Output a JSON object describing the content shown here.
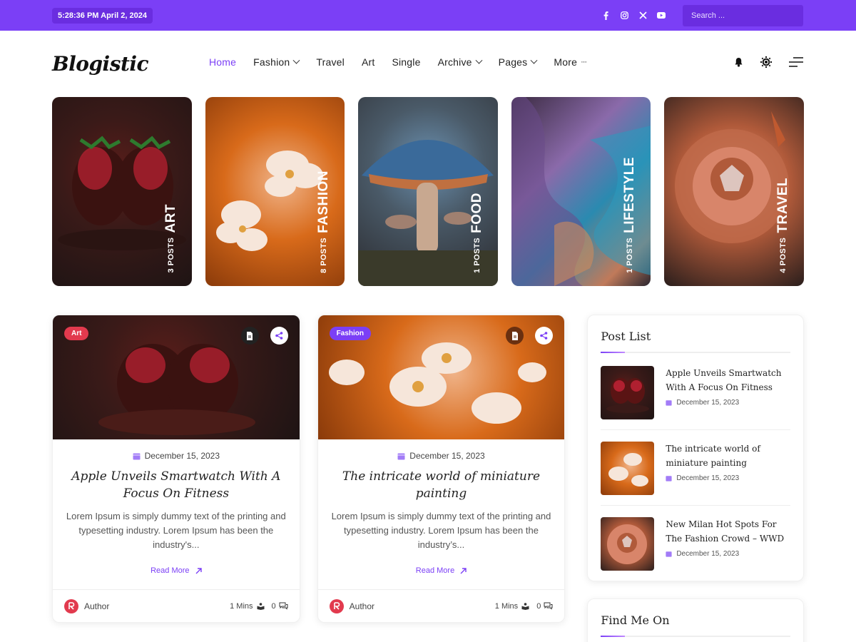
{
  "topbar": {
    "datetime": "5:28:36 PM April 2, 2024",
    "social": [
      "facebook-icon",
      "instagram-icon",
      "x-icon",
      "youtube-icon"
    ],
    "search_placeholder": "Search ..."
  },
  "header": {
    "logo": "Blogistic",
    "nav": [
      {
        "label": "Home",
        "active": true,
        "dropdown": false
      },
      {
        "label": "Fashion",
        "active": false,
        "dropdown": true
      },
      {
        "label": "Travel",
        "active": false,
        "dropdown": false
      },
      {
        "label": "Art",
        "active": false,
        "dropdown": false
      },
      {
        "label": "Single",
        "active": false,
        "dropdown": false
      },
      {
        "label": "Archive",
        "active": false,
        "dropdown": true
      },
      {
        "label": "Pages",
        "active": false,
        "dropdown": true
      },
      {
        "label": "More",
        "active": false,
        "dropdown": false
      }
    ]
  },
  "categories": [
    {
      "name": "ART",
      "count": "3 POSTS"
    },
    {
      "name": "FASHION",
      "count": "8 POSTS"
    },
    {
      "name": "FOOD",
      "count": "1 POSTS"
    },
    {
      "name": "LIFESTYLE",
      "count": "1 POSTS"
    },
    {
      "name": "TRAVEL",
      "count": "4 POSTS"
    }
  ],
  "posts": [
    {
      "badge": "Art",
      "badge_color": "#e23a4e",
      "date": "December 15, 2023",
      "title": "Apple Unveils Smartwatch With A Focus On Fitness",
      "excerpt": "Lorem Ipsum is simply dummy text of the printing and typesetting industry. Lorem Ipsum has been the industry's...",
      "read_more": "Read More",
      "author": "Author",
      "read_time": "1 Mins",
      "comments": "0"
    },
    {
      "badge": "Fashion",
      "badge_color": "#7b3ff6",
      "date": "December 15, 2023",
      "title": "The intricate world of miniature painting",
      "excerpt": "Lorem Ipsum is simply dummy text of the printing and typesetting industry. Lorem Ipsum has been the industry’s...",
      "read_more": "Read More",
      "author": "Author",
      "read_time": "1 Mins",
      "comments": "0"
    }
  ],
  "sidebar": {
    "post_list_title": "Post List",
    "items": [
      {
        "title": "Apple Unveils Smartwatch With A Focus On Fitness",
        "date": "December 15, 2023"
      },
      {
        "title": "The intricate world of miniature painting",
        "date": "December 15, 2023"
      },
      {
        "title": "New Milan Hot Spots For The Fashion Crowd – WWD",
        "date": "December 15, 2023"
      }
    ],
    "find_me_title": "Find Me On"
  },
  "colors": {
    "accent": "#7b3ff6",
    "art_badge": "#e23a4e"
  }
}
